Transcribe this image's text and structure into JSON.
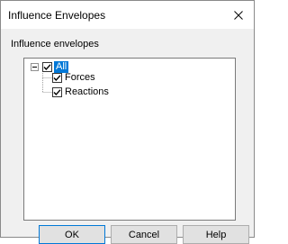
{
  "window": {
    "title": "Influence Envelopes"
  },
  "content": {
    "label": "Influence envelopes"
  },
  "tree": {
    "root": {
      "label": "All",
      "checked": true,
      "expanded": true,
      "selected": true
    },
    "children": [
      {
        "label": "Forces",
        "checked": true
      },
      {
        "label": "Reactions",
        "checked": true
      }
    ]
  },
  "buttons": {
    "ok": "OK",
    "cancel": "Cancel",
    "help": "Help"
  },
  "colors": {
    "selection": "#0078d7",
    "dialog_bg": "#f0f0f0",
    "tree_bg": "#ffffff"
  },
  "icons": {
    "close": "close-icon",
    "expander": "minus-expander-icon",
    "check": "checkmark-icon"
  }
}
